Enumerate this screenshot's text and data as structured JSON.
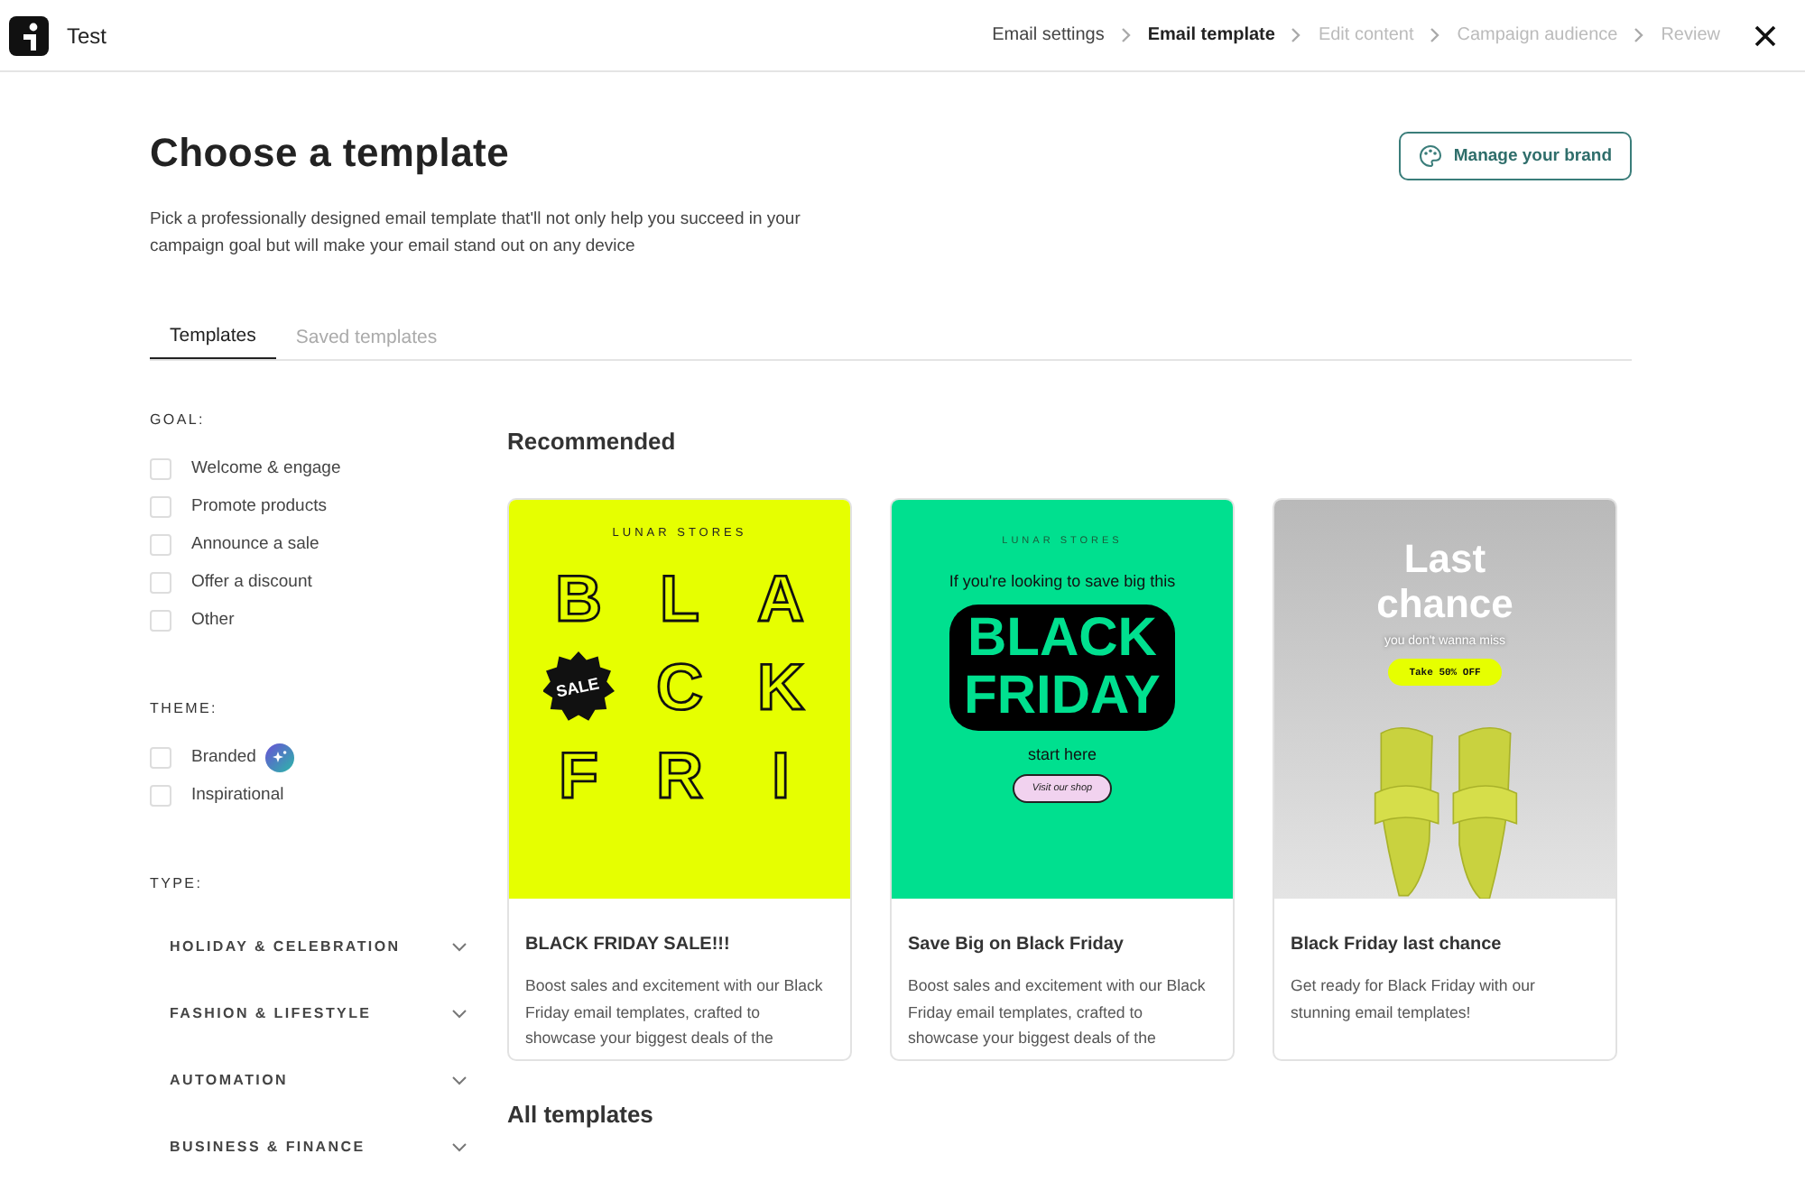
{
  "header": {
    "app_name": "Test",
    "steps": [
      {
        "label": "Email settings",
        "selected": false,
        "disabled": false
      },
      {
        "label": "Email template",
        "selected": true,
        "disabled": false
      },
      {
        "label": "Edit content",
        "selected": false,
        "disabled": true
      },
      {
        "label": "Campaign audience",
        "selected": false,
        "disabled": true
      },
      {
        "label": "Review",
        "selected": false,
        "disabled": true
      }
    ]
  },
  "page": {
    "title": "Choose a template",
    "description": "Pick a professionally designed email template that'll not only help you succeed in your campaign goal but will make your email stand out on any device",
    "brand_button": "Manage your brand"
  },
  "tabs": [
    {
      "label": "Templates",
      "selected": true
    },
    {
      "label": "Saved templates",
      "selected": false
    }
  ],
  "filters": {
    "goal": {
      "heading": "GOAL:",
      "options": [
        {
          "label": "Welcome & engage",
          "checked": false
        },
        {
          "label": "Promote products",
          "checked": false
        },
        {
          "label": "Announce a sale",
          "checked": false
        },
        {
          "label": "Offer a discount",
          "checked": false
        },
        {
          "label": "Other",
          "checked": false
        }
      ]
    },
    "theme": {
      "heading": "THEME:",
      "options": [
        {
          "label": "Branded",
          "checked": false,
          "badge": true
        },
        {
          "label": "Inspirational",
          "checked": false
        }
      ]
    },
    "type": {
      "heading": "TYPE:",
      "groups": [
        {
          "label": "HOLIDAY & CELEBRATION",
          "expanded": false
        },
        {
          "label": "FASHION & LIFESTYLE",
          "expanded": false
        },
        {
          "label": "AUTOMATION",
          "expanded": false
        },
        {
          "label": "BUSINESS & FINANCE",
          "expanded": false
        }
      ]
    }
  },
  "recommended": {
    "heading": "Recommended",
    "cards": [
      {
        "title": "BLACK FRIDAY SALE!!!",
        "description": "Boost sales and excitement with our Black Friday email templates, crafted to showcase your biggest deals of the",
        "preview": {
          "kind": "letters",
          "brand": "LUNAR STORES",
          "letters": [
            "B",
            "L",
            "A",
            "SALE",
            "C",
            "K",
            "F",
            "R",
            "I"
          ]
        }
      },
      {
        "title": "Save Big on Black Friday",
        "description": "Boost sales and excitement with our Black Friday email templates, crafted to showcase your biggest deals of the",
        "preview": {
          "kind": "headline",
          "brand": "LUNAR STORES",
          "intro": "If you're looking to save big this",
          "headline": [
            "BLACK",
            "FRIDAY"
          ],
          "outro": "start here",
          "cta": "Visit our shop"
        }
      },
      {
        "title": "Black Friday last chance",
        "description": "Get ready for Black Friday with our stunning email templates!",
        "preview": {
          "kind": "photo",
          "headline": [
            "Last",
            "chance"
          ],
          "subline": "you don't wanna miss",
          "cta": "Take 50% OFF"
        }
      }
    ]
  },
  "all_templates": {
    "heading": "All templates"
  }
}
